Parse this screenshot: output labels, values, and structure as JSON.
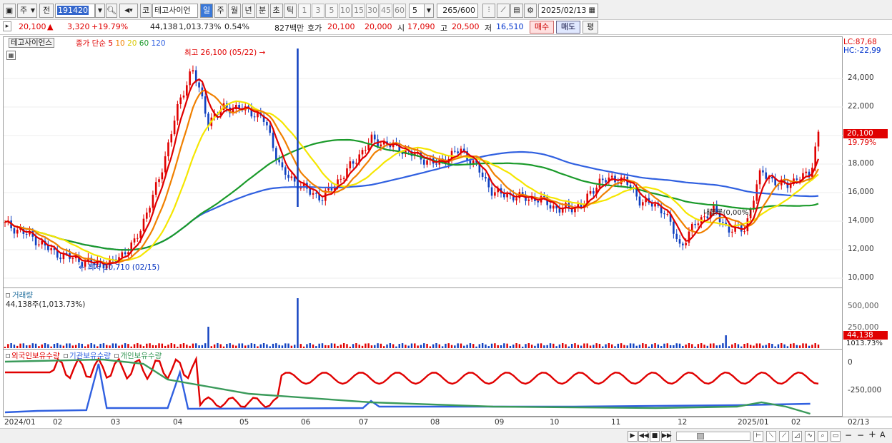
{
  "toolbar": {
    "market_kr": "주",
    "prev_label": "전",
    "code": "191420",
    "type_label": "코",
    "stock_name": "테고사이언",
    "periods": [
      "일",
      "주",
      "월",
      "년",
      "분",
      "초",
      "틱"
    ],
    "active_period": "일",
    "intervals": [
      "1",
      "3",
      "5",
      "10",
      "15",
      "30",
      "45",
      "60"
    ],
    "interval_value": "5",
    "count_current": "265",
    "count_sep": "/",
    "count_total": "600",
    "date": "2025/02/13"
  },
  "quote": {
    "price": "20,100",
    "change": "3,320",
    "change_pct": "+19.79%",
    "volume": "44,138",
    "volume_pct": "1,013.73%",
    "turnover_pct": "0.54%",
    "amount": "827백만",
    "ask_label": "호가",
    "ask1": "20,100",
    "ask2": "20,000",
    "open_label": "시",
    "open": "17,090",
    "high_label": "고",
    "high": "20,500",
    "low_label": "저",
    "low": "16,510",
    "buy_label": "매수",
    "sell_label": "매도",
    "eval_label": "평"
  },
  "price_panel": {
    "stock_tag": "테고사이언스",
    "ma_title": "종가 단순",
    "ma_periods": [
      "5",
      "10",
      "20",
      "60",
      "120"
    ],
    "high_annotation": "최고 26,100 (05/22)",
    "low_annotation": "최저 10,710 (02/15)",
    "overlap_text": "내블루(0,00%)",
    "lc": "LC:87,68",
    "hc": "HC:-22,99",
    "current_price": "20,100",
    "current_pct": "19.79%",
    "y_ticks": [
      "24,000",
      "22,000",
      "20,000",
      "18,000",
      "16,000",
      "14,000",
      "12,000",
      "10,000"
    ]
  },
  "volume_panel": {
    "title": "거래량",
    "value_text": "44,138주(1,013.73%)",
    "y_ticks": [
      "500,000",
      "250,000"
    ],
    "current": "44,138",
    "current_pct": "1013.73%"
  },
  "holder_panel": {
    "legend": [
      "외국인보유수량",
      "기관보유수량",
      "개인보유수량"
    ],
    "y_ticks": [
      "0",
      "-250,000"
    ]
  },
  "x_axis": {
    "labels": [
      "2024/01",
      "02",
      "03",
      "04",
      "05",
      "06",
      "07",
      "08",
      "09",
      "10",
      "11",
      "12",
      "2025/01",
      "02"
    ],
    "end_date": "02/13"
  },
  "colors": {
    "ma5": "#e00000",
    "ma10": "#f08000",
    "ma20": "#f5e600",
    "ma60": "#1a9a2a",
    "ma120": "#3060e0",
    "up": "#e00000",
    "down": "#1040c0",
    "foreign": "#e00000",
    "institution": "#3060e0",
    "individual": "#3a9a5a"
  }
}
